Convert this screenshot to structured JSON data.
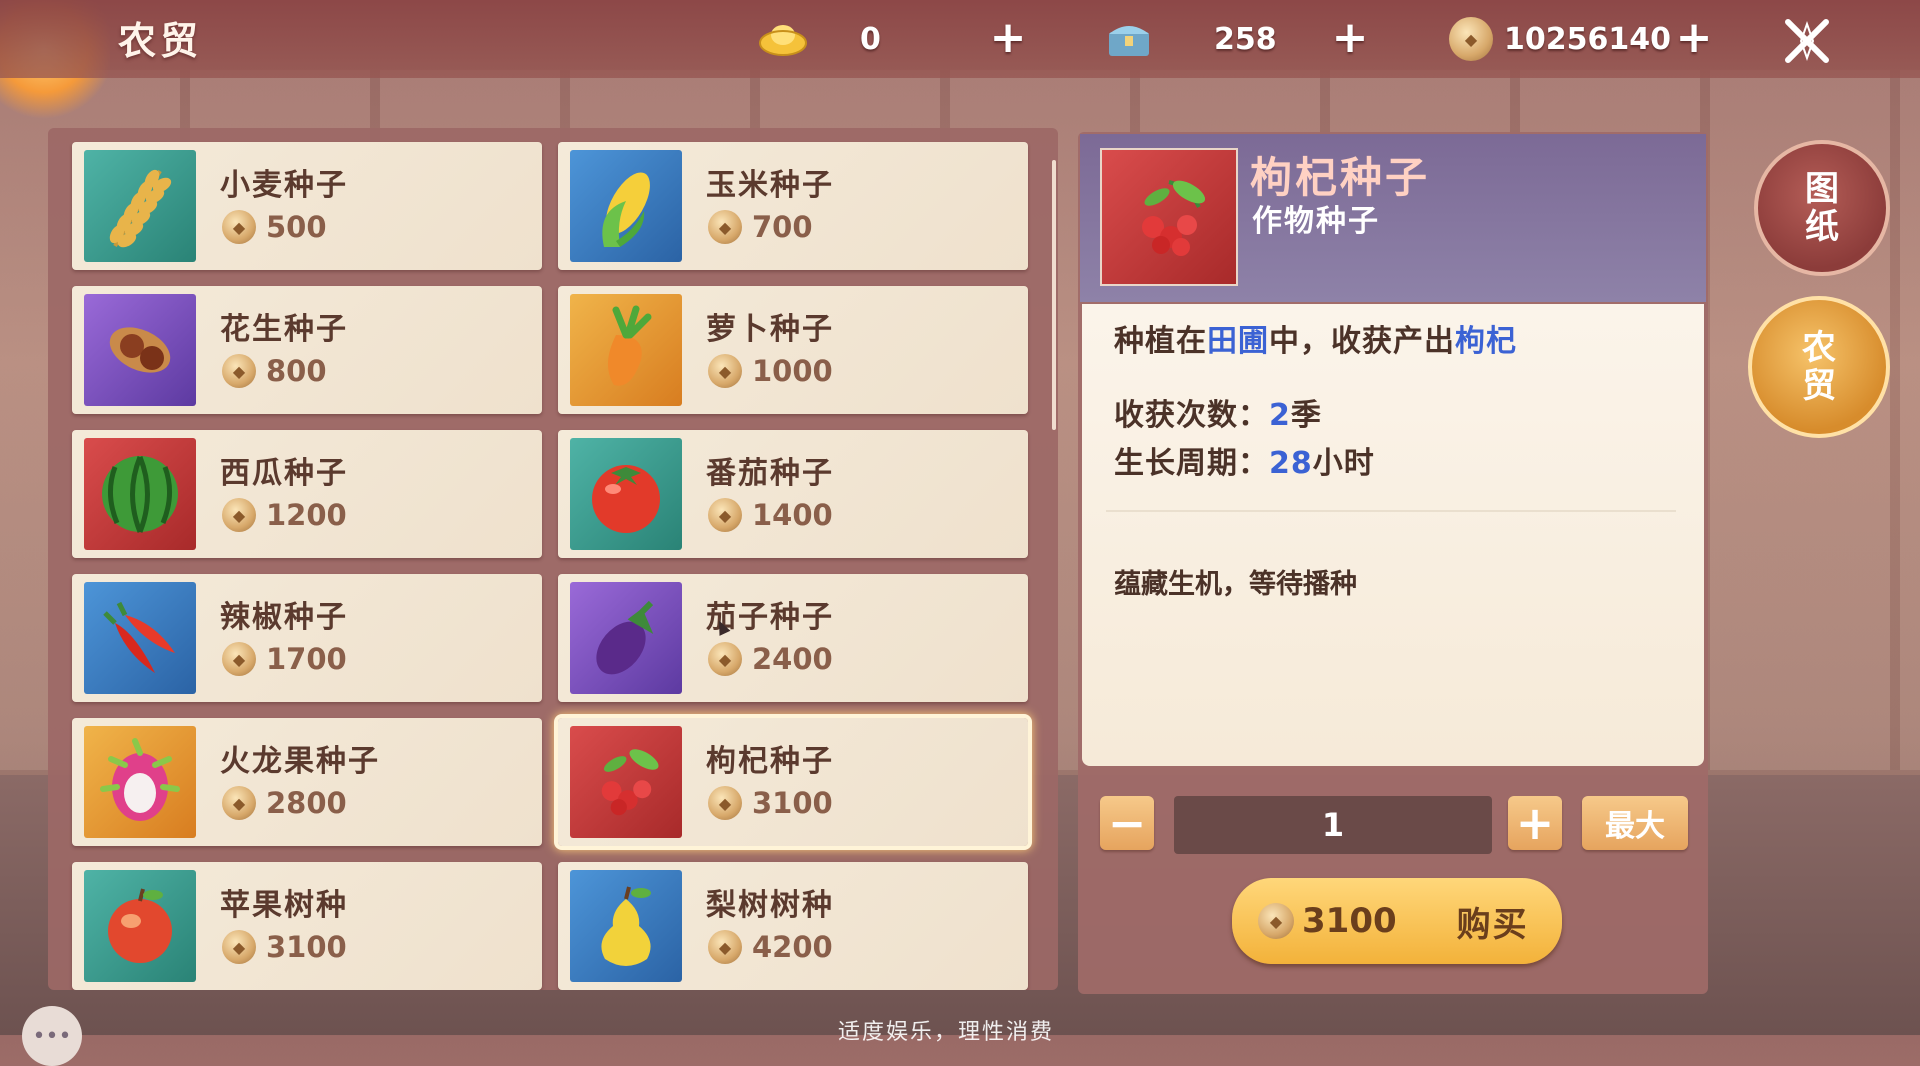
{
  "header": {
    "title": "农贸",
    "gold_ingot": {
      "icon": "gold-ingot-icon",
      "value": "0"
    },
    "chest": {
      "icon": "treasure-chest-icon",
      "value": "258"
    },
    "coins": {
      "icon": "coin-icon",
      "value": "10256140"
    }
  },
  "items": [
    {
      "name": "小麦种子",
      "price": "500",
      "icon": "wheat-icon",
      "tile": "green"
    },
    {
      "name": "玉米种子",
      "price": "700",
      "icon": "corn-icon",
      "tile": "blue"
    },
    {
      "name": "花生种子",
      "price": "800",
      "icon": "peanut-icon",
      "tile": "purple"
    },
    {
      "name": "萝卜种子",
      "price": "1000",
      "icon": "carrot-icon",
      "tile": "orange"
    },
    {
      "name": "西瓜种子",
      "price": "1200",
      "icon": "watermelon-icon",
      "tile": "red"
    },
    {
      "name": "番茄种子",
      "price": "1400",
      "icon": "tomato-icon",
      "tile": "green"
    },
    {
      "name": "辣椒种子",
      "price": "1700",
      "icon": "chili-icon",
      "tile": "blue"
    },
    {
      "name": "茄子种子",
      "price": "2400",
      "icon": "eggplant-icon",
      "tile": "purple"
    },
    {
      "name": "火龙果种子",
      "price": "2800",
      "icon": "dragonfruit-icon",
      "tile": "orange"
    },
    {
      "name": "枸杞种子",
      "price": "3100",
      "icon": "goji-icon",
      "tile": "red",
      "selected": true
    },
    {
      "name": "苹果树种",
      "price": "3100",
      "icon": "apple-icon",
      "tile": "green"
    },
    {
      "name": "梨树树种",
      "price": "4200",
      "icon": "pear-icon",
      "tile": "blue"
    }
  ],
  "detail": {
    "title": "枸杞种子",
    "subtitle": "作物种子",
    "desc_pre": "种植在",
    "desc_place": "田圃",
    "desc_mid": "中，收获产出",
    "desc_product": "枸杞",
    "harvest_label": "收获次数：",
    "harvest_value": "2",
    "harvest_unit": "季",
    "growth_label": "生长周期：",
    "growth_value": "28",
    "growth_unit": "小时",
    "flavor": "蕴藏生机，等待播种"
  },
  "purchase": {
    "quantity": "1",
    "max_label": "最大",
    "total_price": "3100",
    "buy_label": "购买"
  },
  "side": {
    "blueprint_line1": "图",
    "blueprint_line2": "纸",
    "market_line1": "农",
    "market_line2": "贸"
  },
  "footer": "适度娱乐，理性消费"
}
